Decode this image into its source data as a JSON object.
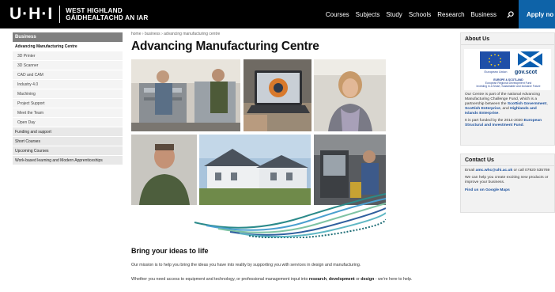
{
  "header": {
    "logo_mark": "U·H·I",
    "logo_line1": "WEST HIGHLAND",
    "logo_line2": "GÀIDHEALTACHD AN IAR",
    "nav": [
      "Courses",
      "Subjects",
      "Study",
      "Schools",
      "Research",
      "Business"
    ],
    "apply_label": "Apply no"
  },
  "sidebar": {
    "heading": "Business",
    "current": "Advancing Manufacturing Centre",
    "sub_items": [
      "3D Printer",
      "3D Scanner",
      "CAD and CAM",
      "Industry 4.0",
      "Machining",
      "Project Support",
      "Meet the Team",
      "Open Day"
    ],
    "top_items": [
      "Funding and support",
      "Short Courses",
      "Upcoming Courses",
      "Work-based learning and Modern Apprenticeships"
    ]
  },
  "main": {
    "breadcrumb": "home › business › advancing manufacturing centre",
    "title": "Advancing Manufacturing Centre",
    "section_heading": "Bring your ideas to life",
    "para1": "Our mission is to help you bring the ideas you have into reality by supporting you with services in design and manufacturing.",
    "para2_start": "Whether you need access to equipment and technology, or professional management input into ",
    "para2_research": "research",
    "para2_comma": ", ",
    "para2_development": "development",
    "para2_or": " or ",
    "para2_design": "design",
    "para2_end": " - we're here to help."
  },
  "about": {
    "title": "About Us",
    "eu_label": "European Union",
    "gov_label": "gov.scot",
    "fund_line1": "EUROPE & SCOTLAND",
    "fund_line2": "European Regional Development Fund",
    "fund_line3": "Investing in a Smart, Sustainable and Inclusive Future",
    "text1_start": "Our Centre is part of the national Advancing Manufacturing Challenge Fund, which is a partnership between the ",
    "link_sfc": "Scottish Government",
    "text1_sep1": ", ",
    "link_se": "Scottish Enterprise",
    "text1_sep2": ", and ",
    "link_hie": "Highlands and Islands Enterprise",
    "text1_end": ".",
    "text2_start": "It is part funded by the 2014-2020 ",
    "link_eu": "European Structural and Investment Fund",
    "text2_end": "."
  },
  "contact": {
    "title": "Contact Us",
    "email_prefix": "Email ",
    "email": "amc.whc@uhi.ac.uk",
    "email_suffix": " or call 07920 535769",
    "text": "We can help you create exciting new products or improve your business.",
    "maps_link": "Find us on Google Maps"
  },
  "colors": {
    "header_bg": "#000000",
    "apply_bg": "#0e63a8",
    "sidebar_heading": "#808080",
    "link": "#1a4f9c"
  }
}
